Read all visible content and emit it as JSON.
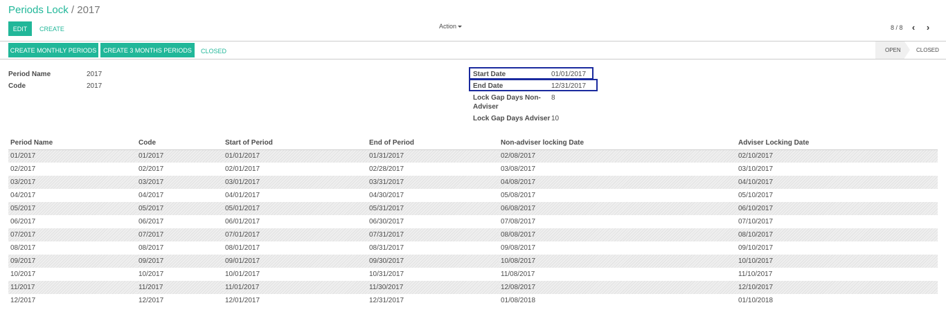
{
  "breadcrumb": {
    "parent": "Periods Lock",
    "separator": "/",
    "current": "2017"
  },
  "toolbar": {
    "edit_label": "EDIT",
    "create_label": "CREATE",
    "action_label": "Action"
  },
  "pager": {
    "value": "8 / 8",
    "prev_icon": "chevron-left-icon",
    "next_icon": "chevron-right-icon"
  },
  "statusbar": {
    "buttons": [
      "CREATE MONTHLY PERIODS",
      "CREATE 3 MONTHS PERIODS",
      "CLOSED"
    ],
    "stages": [
      "OPEN",
      "CLOSED"
    ],
    "active_stage": "OPEN"
  },
  "form": {
    "period_name_label": "Period Name",
    "period_name_value": "2017",
    "code_label": "Code",
    "code_value": "2017",
    "start_date_label": "Start Date",
    "start_date_value": "01/01/2017",
    "end_date_label": "End Date",
    "end_date_value": "12/31/2017",
    "lock_gap_non_adviser_label_line1": "Lock Gap Days Non-",
    "lock_gap_non_adviser_label_line2": "Adviser",
    "lock_gap_non_adviser_value": "8",
    "lock_gap_adviser_label": "Lock Gap Days Adviser",
    "lock_gap_adviser_value": "10"
  },
  "table": {
    "columns": [
      "Period Name",
      "Code",
      "Start of Period",
      "End of Period",
      "Non-adviser locking Date",
      "Adviser Locking Date"
    ],
    "rows": [
      [
        "01/2017",
        "01/2017",
        "01/01/2017",
        "01/31/2017",
        "02/08/2017",
        "02/10/2017"
      ],
      [
        "02/2017",
        "02/2017",
        "02/01/2017",
        "02/28/2017",
        "03/08/2017",
        "03/10/2017"
      ],
      [
        "03/2017",
        "03/2017",
        "03/01/2017",
        "03/31/2017",
        "04/08/2017",
        "04/10/2017"
      ],
      [
        "04/2017",
        "04/2017",
        "04/01/2017",
        "04/30/2017",
        "05/08/2017",
        "05/10/2017"
      ],
      [
        "05/2017",
        "05/2017",
        "05/01/2017",
        "05/31/2017",
        "06/08/2017",
        "06/10/2017"
      ],
      [
        "06/2017",
        "06/2017",
        "06/01/2017",
        "06/30/2017",
        "07/08/2017",
        "07/10/2017"
      ],
      [
        "07/2017",
        "07/2017",
        "07/01/2017",
        "07/31/2017",
        "08/08/2017",
        "08/10/2017"
      ],
      [
        "08/2017",
        "08/2017",
        "08/01/2017",
        "08/31/2017",
        "09/08/2017",
        "09/10/2017"
      ],
      [
        "09/2017",
        "09/2017",
        "09/01/2017",
        "09/30/2017",
        "10/08/2017",
        "10/10/2017"
      ],
      [
        "10/2017",
        "10/2017",
        "10/01/2017",
        "10/31/2017",
        "11/08/2017",
        "11/10/2017"
      ],
      [
        "11/2017",
        "11/2017",
        "11/01/2017",
        "11/30/2017",
        "12/08/2017",
        "12/10/2017"
      ],
      [
        "12/2017",
        "12/2017",
        "12/01/2017",
        "12/31/2017",
        "01/08/2018",
        "01/10/2018"
      ]
    ]
  },
  "colors": {
    "accent": "#21b799",
    "highlight_border": "#1a2a9e",
    "stage_active_bg": "#f0f0f0"
  }
}
